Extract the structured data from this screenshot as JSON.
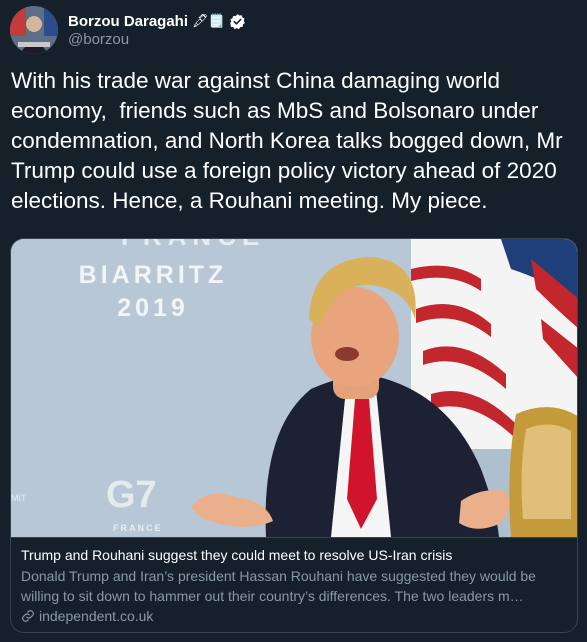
{
  "author": {
    "display_name": "Borzou Daragahi",
    "emoji": "🖋🗒️",
    "handle": "@borzou",
    "verified": true,
    "icons": [
      "pen-emoji",
      "notepad-emoji",
      "verified-badge-icon"
    ]
  },
  "tweet": {
    "text": "With his trade war against China damaging world economy,  friends such as MbS and Bolsonaro under condemnation, and North Korea talks bogged down, Mr Trump could use a foreign policy victory ahead of 2020 elections. Hence, a Rouhani meeting. My piece."
  },
  "card": {
    "image_text": {
      "banner_top": "FRANCE",
      "city": "BIARRITZ",
      "year": "2019",
      "logo": "G7",
      "logo_sub": "FRANCE",
      "side_text": "MIT"
    },
    "title": "Trump and Rouhani suggest they could meet to resolve US-Iran crisis",
    "description": "Donald Trump and Iran’s president Hassan Rouhani have suggested they would be willing to sit down to hammer out their country’s differences. The two leaders m…",
    "domain": "independent.co.uk",
    "link_icon": "link-icon"
  },
  "colors": {
    "background": "#15202b",
    "secondary_text": "#8899a6",
    "border": "#38444d",
    "verified": "#ffffff"
  }
}
